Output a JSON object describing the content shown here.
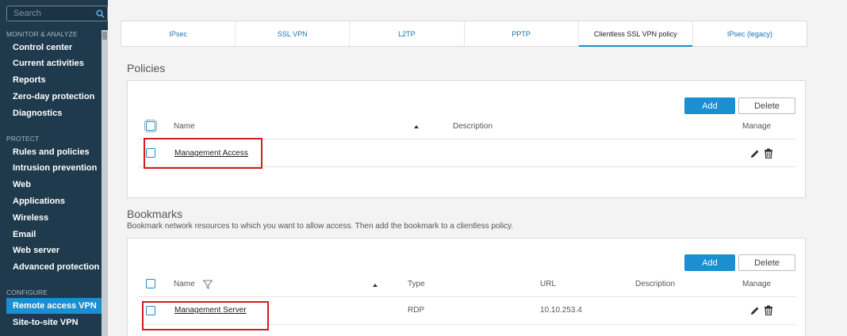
{
  "sidebar": {
    "search_placeholder": "Search",
    "sections": [
      {
        "label": "MONITOR & ANALYZE",
        "items": [
          "Control center",
          "Current activities",
          "Reports",
          "Zero-day protection",
          "Diagnostics"
        ]
      },
      {
        "label": "PROTECT",
        "items": [
          "Rules and policies",
          "Intrusion prevention",
          "Web",
          "Applications",
          "Wireless",
          "Email",
          "Web server",
          "Advanced protection"
        ]
      },
      {
        "label": "CONFIGURE",
        "items": [
          "Remote access VPN",
          "Site-to-site VPN"
        ]
      }
    ],
    "active_item": "Remote access VPN"
  },
  "tabs": [
    {
      "label": "IPsec",
      "active": false
    },
    {
      "label": "SSL VPN",
      "active": false
    },
    {
      "label": "L2TP",
      "active": false
    },
    {
      "label": "PPTP",
      "active": false
    },
    {
      "label": "Clientless SSL VPN policy",
      "active": true
    },
    {
      "label": "IPsec (legacy)",
      "active": false
    }
  ],
  "policies": {
    "heading": "Policies",
    "add_label": "Add",
    "delete_label": "Delete",
    "columns": {
      "name": "Name",
      "description": "Description",
      "manage": "Manage"
    },
    "rows": [
      {
        "name": "Management Access",
        "description": ""
      }
    ]
  },
  "bookmarks": {
    "heading": "Bookmarks",
    "description": "Bookmark network resources to which you want to allow access. Then add the bookmark to a clientless policy.",
    "add_label": "Add",
    "delete_label": "Delete",
    "columns": {
      "name": "Name",
      "type": "Type",
      "url": "URL",
      "description": "Description",
      "manage": "Manage"
    },
    "rows": [
      {
        "name": "Management Server",
        "type": "RDP",
        "url": "10.10.253.4",
        "description": ""
      }
    ]
  },
  "colors": {
    "accent": "#1a8fd1",
    "sidebar_bg": "#1e3a4c",
    "highlight": "#d71920"
  }
}
